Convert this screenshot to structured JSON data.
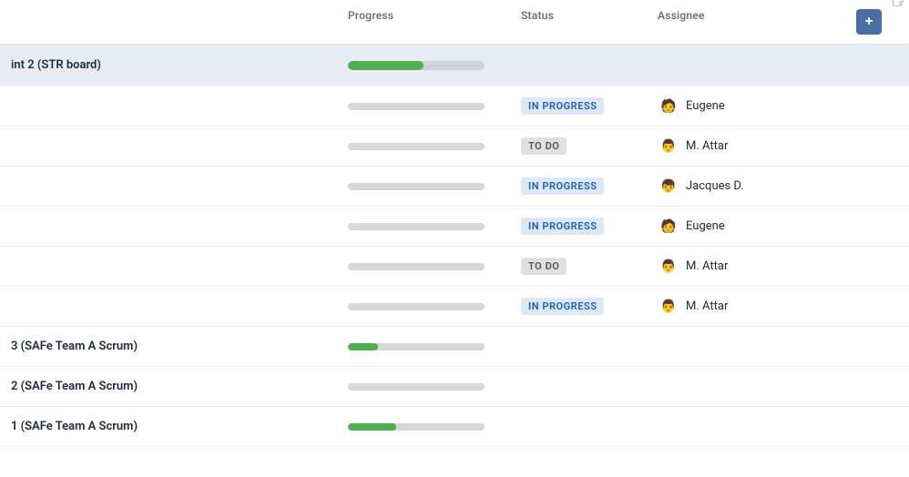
{
  "header": {
    "columns": [
      "",
      "Progress",
      "Status",
      "Assignee",
      ""
    ]
  },
  "rows": [
    {
      "type": "sprint",
      "name": "int 2 (STR board)",
      "progress": 55,
      "status": null,
      "assignee": null
    },
    {
      "type": "task",
      "name": "",
      "progress": 0,
      "status": "IN PROGRESS",
      "statusClass": "status-in-progress",
      "assignee": "Eugene",
      "avatar": "🧑"
    },
    {
      "type": "task",
      "name": "",
      "progress": 0,
      "status": "TO DO",
      "statusClass": "status-to-do",
      "assignee": "M. Attar",
      "avatar": "👨"
    },
    {
      "type": "task",
      "name": "",
      "progress": 0,
      "status": "IN PROGRESS",
      "statusClass": "status-in-progress",
      "assignee": "Jacques D.",
      "avatar": "👦"
    },
    {
      "type": "task",
      "name": "",
      "progress": 0,
      "status": "IN PROGRESS",
      "statusClass": "status-in-progress",
      "assignee": "Eugene",
      "avatar": "🧑"
    },
    {
      "type": "task",
      "name": "",
      "progress": 0,
      "status": "TO DO",
      "statusClass": "status-to-do",
      "assignee": "M. Attar",
      "avatar": "👨"
    },
    {
      "type": "task",
      "name": "",
      "progress": 0,
      "status": "IN PROGRESS",
      "statusClass": "status-in-progress",
      "assignee": "M. Attar",
      "avatar": "👨"
    },
    {
      "type": "sprint-bottom",
      "name": "3 (SAFe Team A Scrum)",
      "progress": 22,
      "status": null,
      "assignee": null
    },
    {
      "type": "sprint-bottom",
      "name": "2 (SAFe Team A Scrum)",
      "progress": 0,
      "status": null,
      "assignee": null
    },
    {
      "type": "sprint-bottom",
      "name": "1 (SAFe Team A Scrum)",
      "progress": 35,
      "status": null,
      "assignee": null
    }
  ],
  "addButton": "+",
  "avatarEmojis": {
    "Eugene": "🧑",
    "M. Attar": "👨",
    "Jacques D.": "👦"
  }
}
